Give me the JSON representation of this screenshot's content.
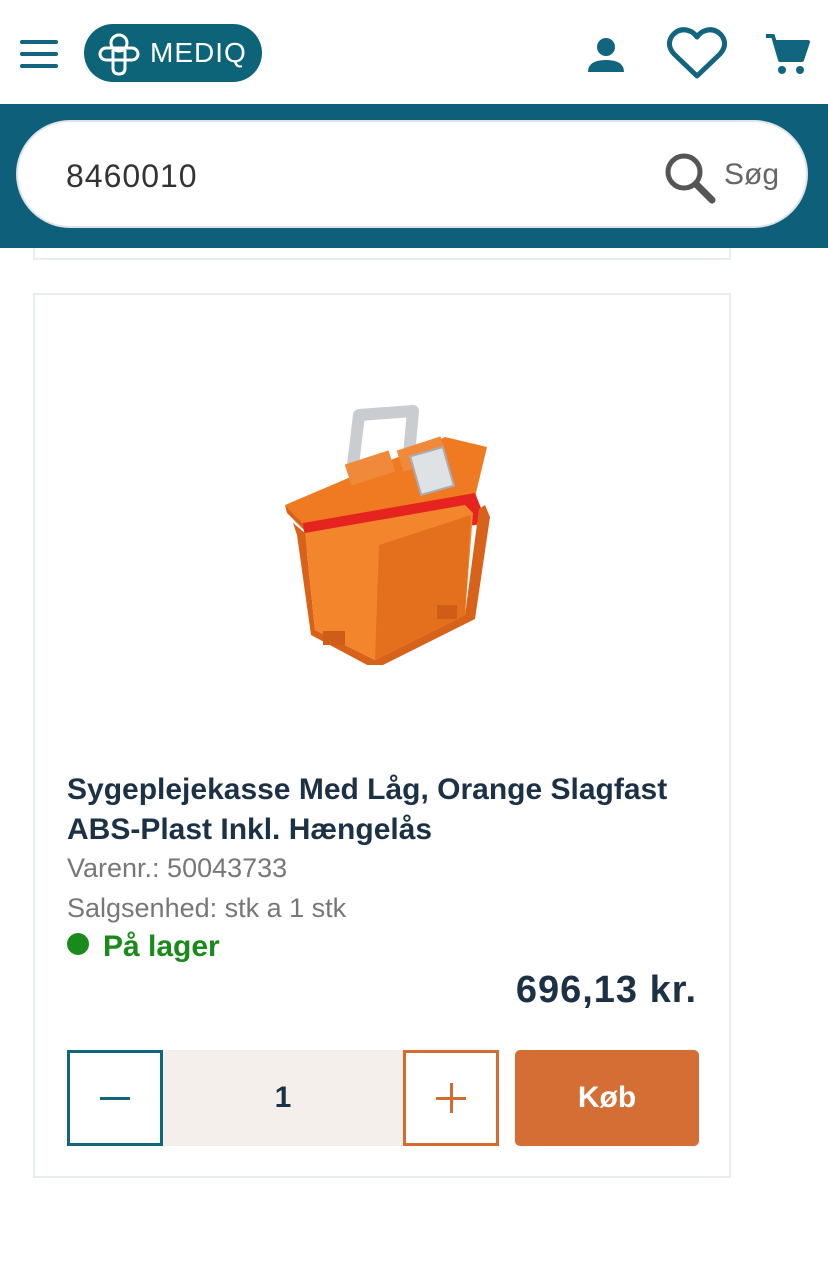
{
  "header": {
    "logo_text": "MEDIQ",
    "icons": [
      "menu-icon",
      "user-icon",
      "heart-icon",
      "cart-icon"
    ],
    "accent_color": "#0d6378"
  },
  "search": {
    "value": "8460010",
    "button_label": "Søg"
  },
  "product": {
    "title": "Sygeplejekasse Med Låg, Orange Slagfast ABS-Plast Inkl. Hængelås",
    "item_number": "Varenr.: 50043733",
    "sales_unit": "Salgsenhed: stk a 1 stk",
    "stock_status": "På lager",
    "stock_color": "#1a8a1a",
    "price": "696,13 kr.",
    "quantity": "1",
    "buy_label": "Køb",
    "buy_color": "#d56e34"
  }
}
